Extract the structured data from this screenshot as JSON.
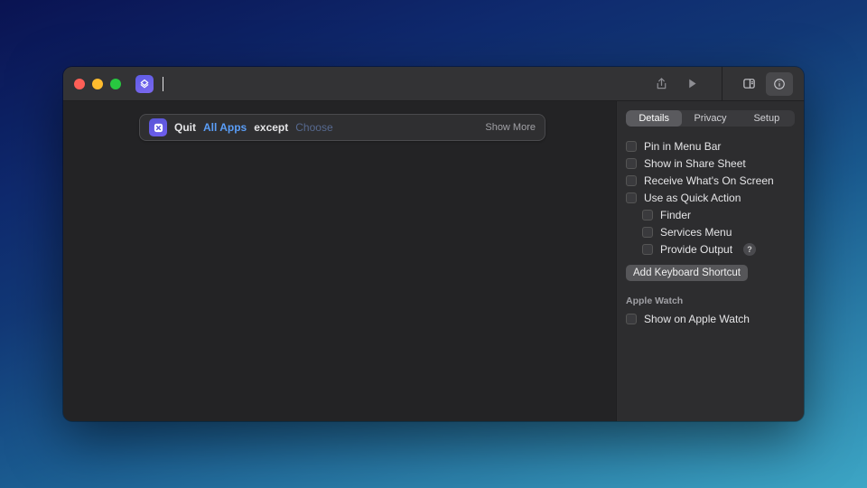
{
  "action": {
    "quit": "Quit",
    "all_apps": "All Apps",
    "except": "except",
    "choose": "Choose",
    "show_more": "Show More"
  },
  "tabs": {
    "details": "Details",
    "privacy": "Privacy",
    "setup": "Setup",
    "active": "details"
  },
  "opts": {
    "pin_menu_bar": "Pin in Menu Bar",
    "show_share_sheet": "Show in Share Sheet",
    "receive_on_screen": "Receive What's On Screen",
    "use_quick_action": "Use as Quick Action",
    "finder": "Finder",
    "services_menu": "Services Menu",
    "provide_output": "Provide Output",
    "help": "?"
  },
  "kb_button": "Add Keyboard Shortcut",
  "watch": {
    "section": "Apple Watch",
    "show": "Show on Apple Watch"
  }
}
